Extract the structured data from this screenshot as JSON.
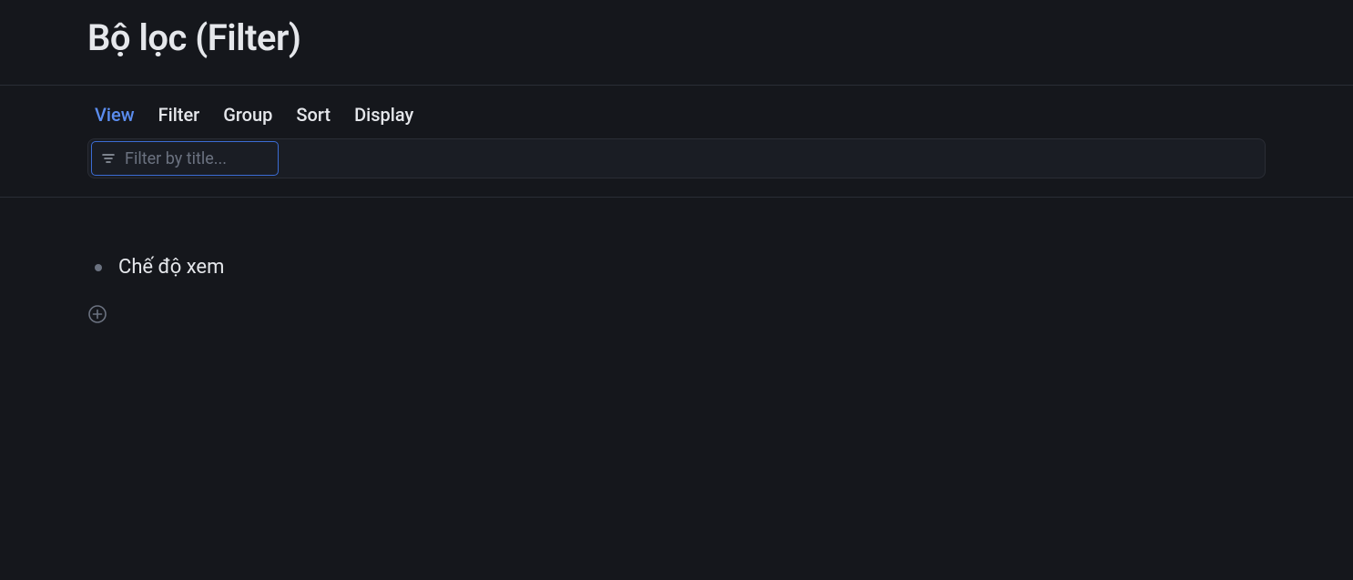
{
  "header": {
    "title": "Bộ lọc (Filter)"
  },
  "tabs": {
    "view": "View",
    "filter": "Filter",
    "group": "Group",
    "sort": "Sort",
    "display": "Display"
  },
  "filter": {
    "placeholder": "Filter by title..."
  },
  "content": {
    "items": [
      {
        "label": "Chế độ xem"
      }
    ]
  }
}
